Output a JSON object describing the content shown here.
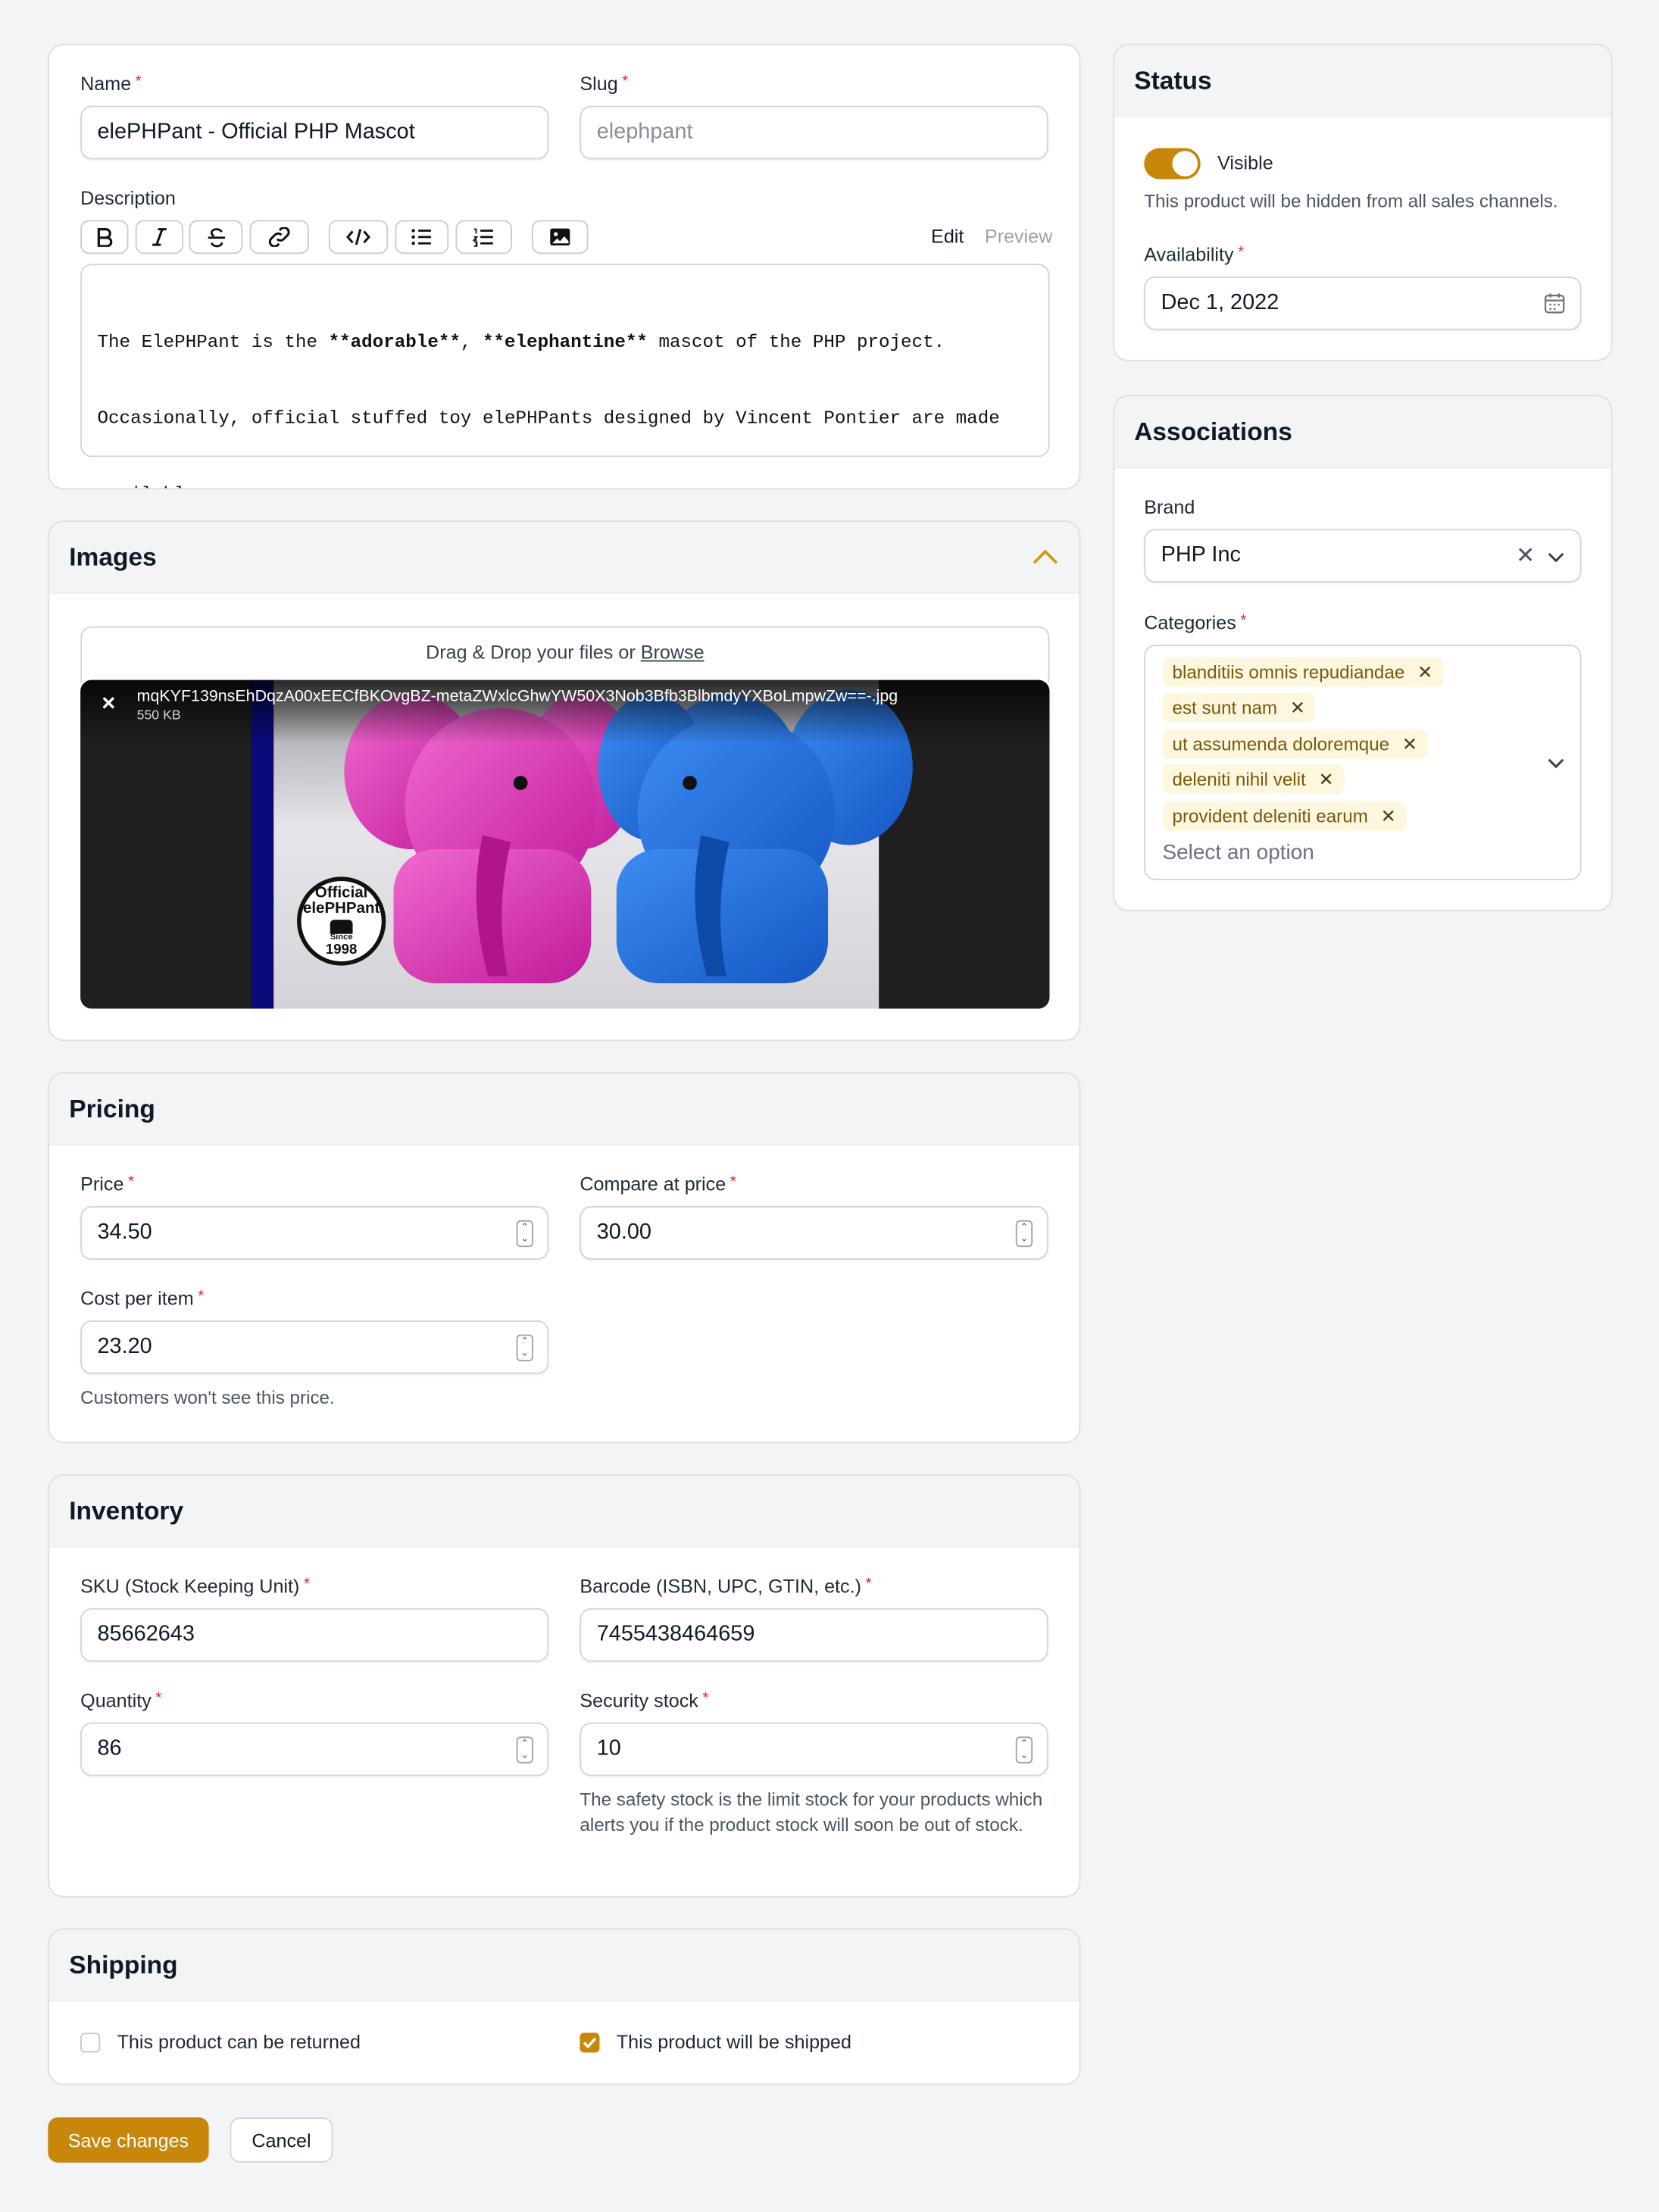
{
  "product": {
    "name_label": "Name",
    "name_value": "elePHPant - Official PHP Mascot",
    "slug_label": "Slug",
    "slug_placeholder": "elephpant",
    "description_label": "Description",
    "editor_tabs": {
      "edit": "Edit",
      "preview": "Preview"
    },
    "description_lines": [
      [
        "The ElePHPant is the ",
        "**adorable**",
        ", ",
        "**elephantine**",
        " mascot of the PHP project."
      ],
      [
        "Occasionally, official stuffed toy elePHPants designed by Vincent Pontier are made"
      ],
      [
        "available."
      ]
    ]
  },
  "images": {
    "title": "Images",
    "dropzone_text": "Drag & Drop your files or",
    "browse_link": "Browse",
    "file_name": "mqKYF139nsEhDqzA00xEECfBKOvgBZ-metaZWxlcGhwYW50X3Nob3Bfb3BlbmdyYXBoLmpwZw==-.jpg",
    "file_size": "550 KB",
    "badge_lines": [
      "Official",
      "elePHPant",
      "Since",
      "1998"
    ]
  },
  "pricing": {
    "title": "Pricing",
    "price_label": "Price",
    "price_value": "34.50",
    "compare_label": "Compare at price",
    "compare_value": "30.00",
    "cost_label": "Cost per item",
    "cost_value": "23.20",
    "cost_help": "Customers won't see this price."
  },
  "inventory": {
    "title": "Inventory",
    "sku_label": "SKU (Stock Keeping Unit)",
    "sku_value": "85662643",
    "barcode_label": "Barcode (ISBN, UPC, GTIN, etc.)",
    "barcode_value": "7455438464659",
    "quantity_label": "Quantity",
    "quantity_value": "86",
    "security_label": "Security stock",
    "security_value": "10",
    "security_help": "The safety stock is the limit stock for your products which alerts you if the product stock will soon be out of stock."
  },
  "shipping": {
    "title": "Shipping",
    "returnable_label": "This product can be returned",
    "returnable_checked": false,
    "shipped_label": "This product will be shipped",
    "shipped_checked": true
  },
  "actions": {
    "save": "Save changes",
    "cancel": "Cancel"
  },
  "status": {
    "title": "Status",
    "visible_label": "Visible",
    "visible_on": true,
    "visible_help": "This product will be hidden from all sales channels.",
    "availability_label": "Availability",
    "availability_value": "Dec 1, 2022"
  },
  "associations": {
    "title": "Associations",
    "brand_label": "Brand",
    "brand_value": "PHP Inc",
    "categories_label": "Categories",
    "categories": [
      "blanditiis omnis repudiandae",
      "est sunt nam",
      "ut assumenda doloremque",
      "deleniti nihil velit",
      "provident deleniti earum"
    ],
    "categories_placeholder": "Select an option"
  },
  "colors": {
    "accent": "#c8860b",
    "required": "#dc2626"
  },
  "icons": {
    "bold": "bold-icon",
    "italic": "italic-icon",
    "strike": "strikethrough-icon",
    "link": "link-icon",
    "code": "code-icon",
    "bullets": "bullet-list-icon",
    "numbered": "numbered-list-icon",
    "image": "image-icon",
    "collapse": "chevron-up-icon",
    "calendar": "calendar-icon",
    "clear": "close-icon",
    "dropdown": "chevron-down-icon"
  }
}
